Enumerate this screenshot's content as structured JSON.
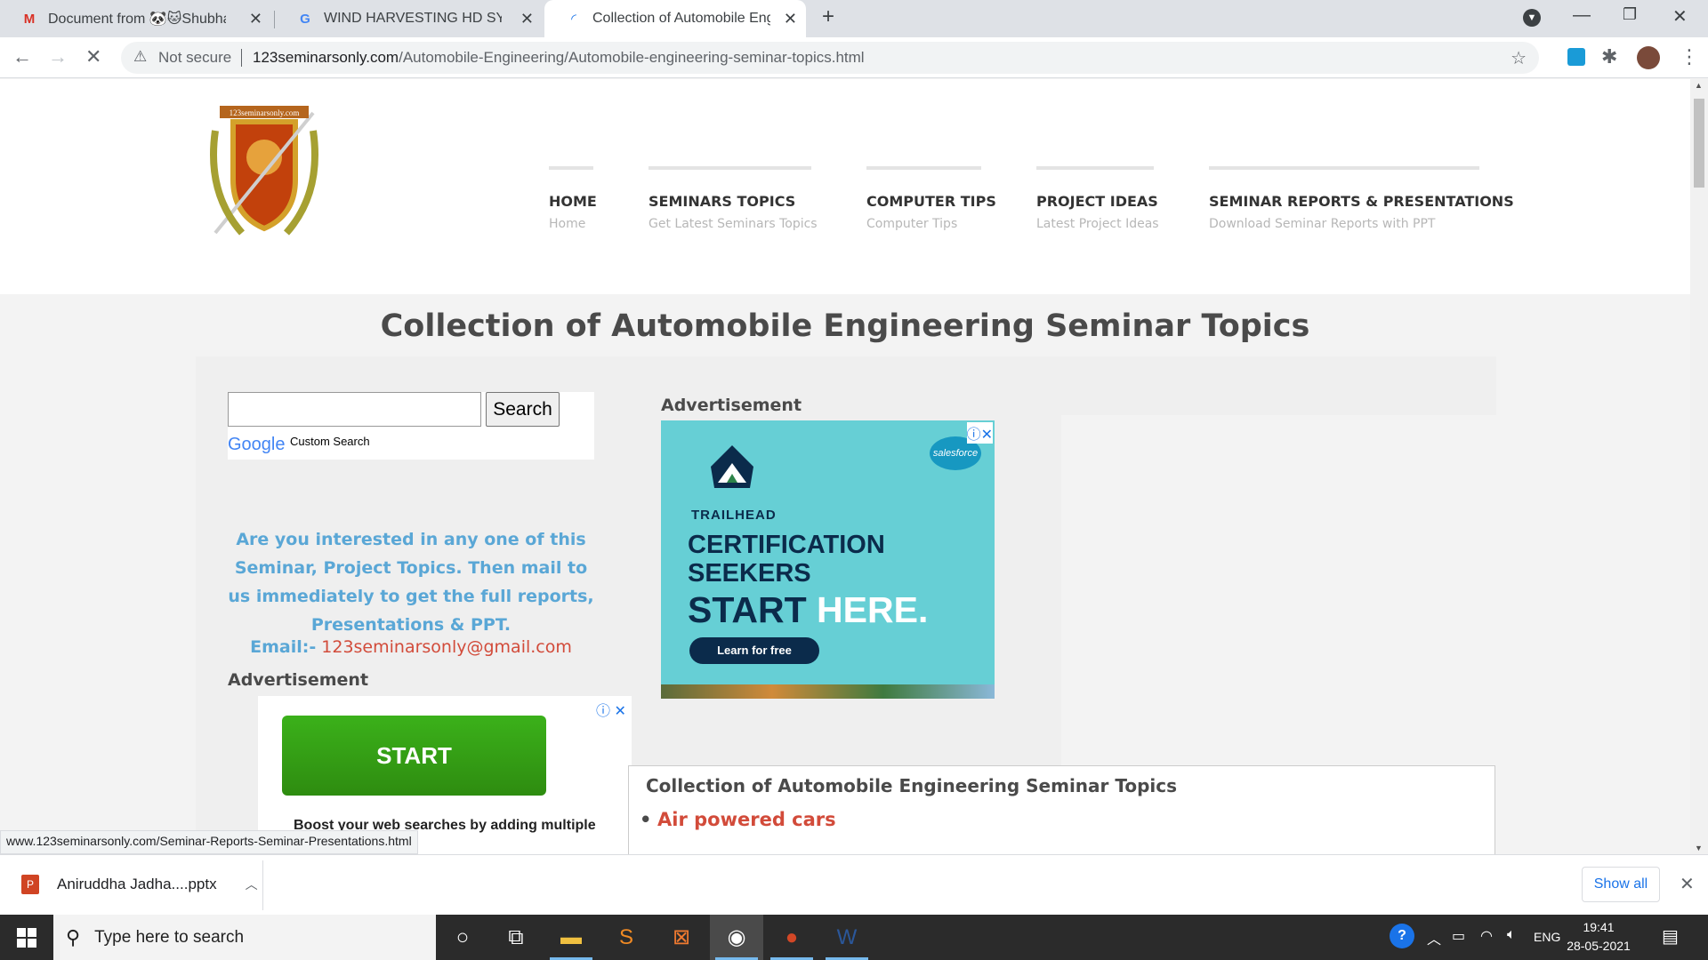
{
  "browser": {
    "tabs": [
      {
        "favicon": "gmail-icon",
        "title": "Document from 🐼🐱Shubham🌘"
      },
      {
        "favicon": "google-icon",
        "title": "WIND HARVESTING HD SYMBOL"
      },
      {
        "favicon": "loading-spinner-icon",
        "title": "Collection of Automobile Engineer"
      }
    ],
    "new_tab": "+",
    "security_label": "Not secure",
    "url_host": "123seminarsonly.com",
    "url_path": "/Automobile-Engineering/Automobile-engineering-seminar-topics.html"
  },
  "site": {
    "logo_text": "123seminarsonly.com",
    "nav": [
      {
        "title": "HOME",
        "sub": "Home"
      },
      {
        "title": "SEMINARS TOPICS",
        "sub": "Get Latest Seminars Topics"
      },
      {
        "title": "COMPUTER TIPS",
        "sub": "Computer Tips"
      },
      {
        "title": "PROJECT IDEAS",
        "sub": "Latest Project Ideas"
      },
      {
        "title": "SEMINAR REPORTS & PRESENTATIONS",
        "sub": "Download Seminar Reports with PPT"
      }
    ],
    "page_title": "Collection of Automobile Engineering Seminar Topics",
    "search": {
      "button": "Search",
      "google": "Google",
      "custom": "Custom Search"
    },
    "promo": "Are you interested in any one of this Seminar, Project Topics. Then mail to us immediately to get the full reports, Presentations & PPT.",
    "email_label": "Email:-",
    "email_value": "123seminarsonly@gmail.com",
    "ad_label": "Advertisement",
    "ad1": {
      "brand": "TRAILHEAD",
      "line1": "CERTIFICATION",
      "line2": "SEEKERS",
      "start": "START",
      "here": "HERE.",
      "cta": "Learn for free",
      "badge": "salesforce"
    },
    "ad2": {
      "button": "START",
      "text": "Boost your web searches by adding multiple"
    },
    "topics_heading": "Collection of Automobile Engineering Seminar Topics",
    "topics": [
      "Air powered cars"
    ],
    "status_url": "www.123seminarsonly.com/Seminar-Reports-Seminar-Presentations.html"
  },
  "download_bar": {
    "file": "Aniruddha Jadha....pptx",
    "show_all": "Show all"
  },
  "taskbar": {
    "search_placeholder": "Type here to search",
    "lang": "ENG",
    "time": "19:41",
    "date": "28-05-2021"
  }
}
